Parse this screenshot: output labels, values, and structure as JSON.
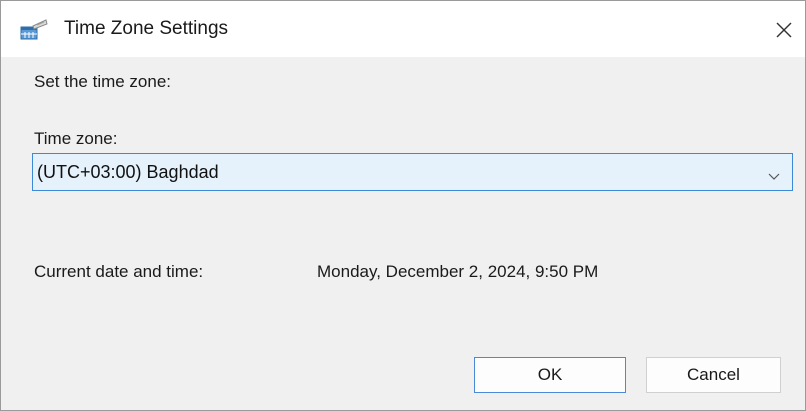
{
  "window": {
    "title": "Time Zone Settings",
    "icon": "time-zone-settings-icon",
    "close_icon": "close-icon"
  },
  "dialog": {
    "instruction": "Set the time zone:",
    "timezone_label": "Time zone:",
    "timezone_selected": "(UTC+03:00) Baghdad",
    "current_label": "Current date and time:",
    "current_value": "Monday, December 2, 2024, 9:50 PM"
  },
  "buttons": {
    "ok": "OK",
    "cancel": "Cancel"
  },
  "colors": {
    "select_bg": "#e5f1fb",
    "select_border": "#3c8ad7",
    "ok_border": "#4a8ad6",
    "window_bg": "#f0f0f0"
  }
}
